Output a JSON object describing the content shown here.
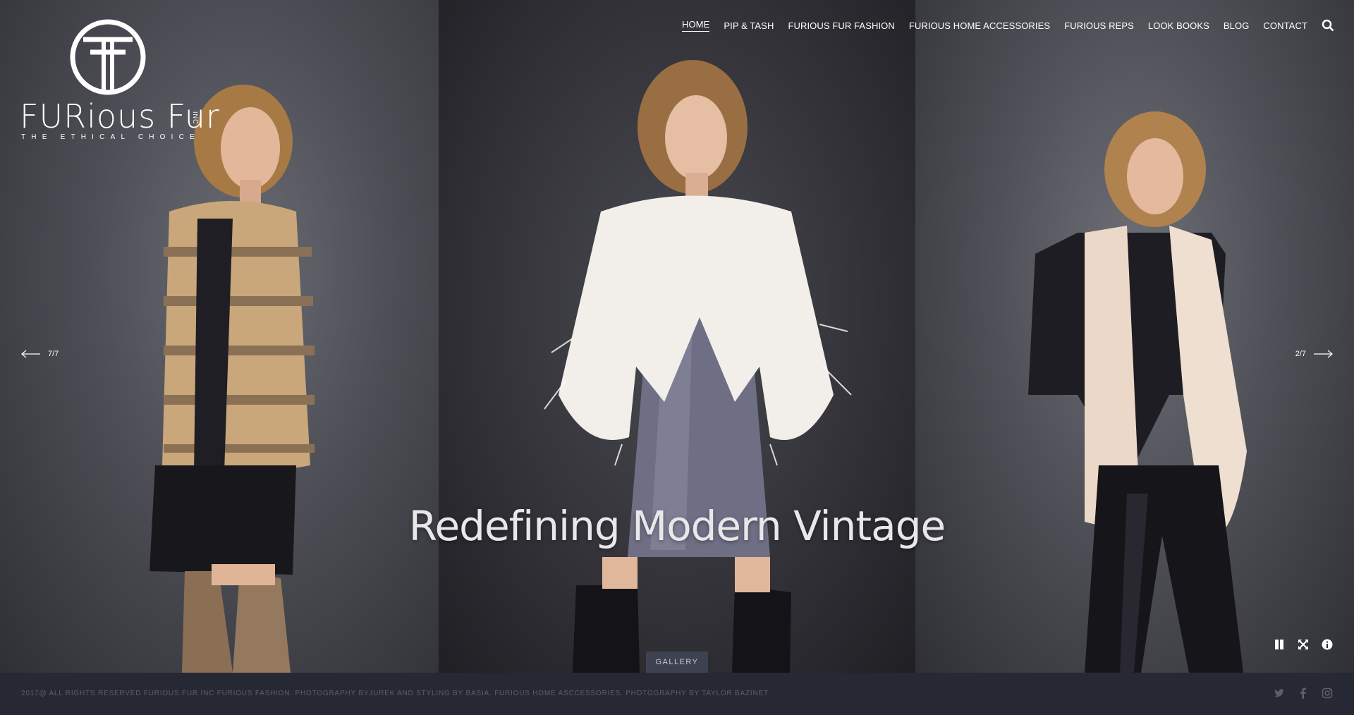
{
  "logo": {
    "text": "FURious Fur",
    "inc": "INC",
    "tagline": "THE ETHICAL CHOICE"
  },
  "nav": {
    "items": [
      {
        "label": "HOME",
        "active": true
      },
      {
        "label": "PIP & TASH",
        "active": false
      },
      {
        "label": "FURIOUS FUR FASHION",
        "active": false
      },
      {
        "label": "FURIOUS HOME ACCESSORIES",
        "active": false
      },
      {
        "label": "FURIOUS REPS",
        "active": false
      },
      {
        "label": "LOOK BOOKS",
        "active": false
      },
      {
        "label": "BLOG",
        "active": false
      },
      {
        "label": "CONTACT",
        "active": false
      }
    ],
    "search_icon": "search-icon"
  },
  "slider": {
    "prev_counter": "7/7",
    "next_counter": "2/7",
    "caption": "Redefining Modern Vintage",
    "gallery_label": "GALLERY",
    "controls": [
      "pause-icon",
      "fullscreen-icon",
      "info-icon"
    ]
  },
  "footer": {
    "text": "2017@ ALL RIGHTS RESERVED FURIOUS FUR INC FURIOUS FASHION. PHOTOGRAPHY BYJUREK AND STYLING BY BASIA. FURIOUS HOME ASCCESSORIES. PHOTOGRAPHY BY TAYLOR BAZINET",
    "social": [
      "twitter-icon",
      "facebook-icon",
      "instagram-icon"
    ]
  },
  "colors": {
    "footer_bg": "#262933",
    "footer_text": "#5b5f6d",
    "gallery_bg": "#3e4150"
  }
}
